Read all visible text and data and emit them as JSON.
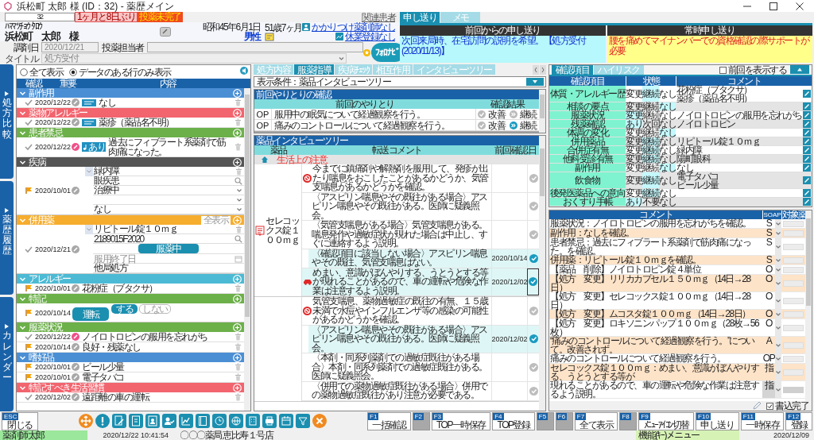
{
  "window": {
    "title": "浜松町 太郎 様 (ID：32) - 薬歴メイン"
  },
  "patient": {
    "id": "32",
    "interval": "1ヶ月と8日ぶり",
    "exam_status": "投薬未完了",
    "related_link": "関連患者",
    "kana": "ﾊﾏﾏﾂﾁｮｳ ﾀﾛｳ",
    "name": "浜松町　太郎　様",
    "birthdate": "昭和45年6月1日",
    "age": "51歳7ヶ月",
    "sex": "男性",
    "pharmacist_link": "かかりつけ薬剤師なし",
    "leave_link": "休業登録なし"
  },
  "dispense": {
    "date_label": "調剤日",
    "date": "2020/12/21",
    "staff_label": "投薬担当者",
    "title_label": "タイトル",
    "title": "処方受付"
  },
  "logo": {
    "label": "ﾌｫﾛﾅﾋﾞ"
  },
  "handover": {
    "tabs": [
      {
        "label": "申し送り",
        "selected": true
      },
      {
        "label": "メモ",
        "selected": false
      }
    ],
    "previous": {
      "heading": "前回からの申し送り",
      "text": "次回来局時、在宅訪問の説明を希望。【処方受付(2020/11/13)】"
    },
    "permanent": {
      "heading": "常時申し送り",
      "text": "腰を痛めてマイナンバーでの資格確認の際サポートが必要"
    }
  },
  "side_tabs": [
    {
      "label": "処方比較"
    },
    {
      "label": "薬歴履歴"
    },
    {
      "label": "カレンダー"
    }
  ],
  "left_panel": {
    "filters": [
      {
        "label": "全て表示",
        "selected": false
      },
      {
        "label": "データのある行のみ表示",
        "selected": true
      }
    ],
    "columns": [
      "確認",
      "重要",
      "内容"
    ],
    "sections": [
      {
        "title": "副作用",
        "color": "#4a8fd4",
        "kind": "entries",
        "rows": [
          {
            "kind": "check",
            "date": "2020/12/22",
            "important": false,
            "badge": {
              "kind": "info"
            },
            "text": "なし"
          }
        ]
      },
      {
        "title": "薬物アレルギー",
        "color": "#f2646e",
        "kind": "entries",
        "rows": [
          {
            "kind": "check",
            "date": "2020/12/22",
            "important": false,
            "badge": {
              "kind": "info"
            },
            "text": "薬疹（薬品名不明）"
          }
        ]
      },
      {
        "title": "患者禁忌",
        "color": "#6cb04a",
        "kind": "entries",
        "rows": [
          {
            "kind": "check",
            "date": "2020/12/22",
            "important": true,
            "badge": {
              "kind": "note",
              "label": "あり"
            },
            "text": "過去にフィブラート系薬剤で筋肉痛になった。"
          }
        ]
      },
      {
        "title": "疾病",
        "color": "#555555",
        "kind": "form",
        "entry": {
          "kind": "flag",
          "date": "2020/10/01",
          "important": false
        },
        "fields": [
          {
            "kind": "text",
            "value": "緑内障"
          },
          {
            "kind": "search",
            "value": "眼疾患"
          },
          {
            "kind": "select",
            "value": "治療中"
          },
          {
            "kind": "select"
          },
          {
            "kind": "select",
            "value": "なし"
          }
        ]
      },
      {
        "title": "併用薬",
        "color": "#f6ad2e",
        "kind": "form",
        "show_all": "全表示",
        "entry": {
          "kind": "check",
          "date": "2020/12/21",
          "important": false
        },
        "fields": [
          {
            "kind": "text",
            "value": "リピトール錠１０ｍｇ"
          },
          {
            "kind": "search",
            "value": "2189015F2020"
          },
          {
            "kind": "status",
            "value": "服薬中"
          },
          {
            "kind": "date",
            "placeholder": "服用終了日"
          },
          {
            "kind": "plain",
            "value": "他局処方"
          }
        ]
      },
      {
        "title": "アレルギー",
        "color": "#4cbad4",
        "kind": "entries",
        "rows": [
          {
            "kind": "flag",
            "date": "2020/10/01",
            "important": false,
            "text": "花粉症（ブタクサ）"
          }
        ]
      },
      {
        "title": "特記",
        "color": "#6cb04a",
        "kind": "note",
        "entry": {
          "kind": "flag",
          "date": "2020/10/14"
        },
        "label": "運転",
        "options": [
          {
            "label": "する",
            "selected": true
          },
          {
            "label": "しない",
            "selected": false
          }
        ]
      },
      {
        "title": "服薬状況",
        "color": "#6cb04a",
        "kind": "entries",
        "rows": [
          {
            "kind": "check",
            "date": "2020/12/22",
            "important": true,
            "text": "ノイロトロピンの服用を忘れがち"
          },
          {
            "kind": "flag",
            "date": "2020/10/14",
            "important": false,
            "text": "良好・残薬なし"
          }
        ]
      },
      {
        "title": "嗜好品",
        "color": "#4a8fd4",
        "kind": "entries",
        "rows": [
          {
            "kind": "flag",
            "date": "2020/10/01",
            "important": false,
            "text": "ビール少量"
          },
          {
            "kind": "flag",
            "date": "2020/10/01",
            "important": false,
            "text": "電子タバコ"
          }
        ]
      },
      {
        "title": "特記すべき生活習慣",
        "color": "#f2646e",
        "kind": "entries",
        "rows": [
          {
            "kind": "check",
            "date": "2020/12/02",
            "important": false,
            "text": "遠距離の車の運転"
          }
        ]
      }
    ]
  },
  "middle": {
    "tabs": [
      {
        "label": "処方内容",
        "selected": false
      },
      {
        "label": "服薬指導",
        "selected": true
      },
      {
        "label": "疾病ﾁｪｯｸ",
        "selected": false
      },
      {
        "label": "相互作用",
        "selected": false
      },
      {
        "label": "インタビューツリー",
        "selected": false
      }
    ],
    "condition": "表示条件：薬品インタビューツリー",
    "previous": {
      "title": "前回やりとりの確認",
      "columns": [
        "前回のやりとり",
        "確認結果"
      ],
      "rows": [
        {
          "soap": "OP",
          "text": "服用中の眠気について経過観察を行う。",
          "options": [
            {
              "label": "改善",
              "selected": false
            },
            {
              "label": "継続",
              "selected": false
            }
          ]
        },
        {
          "soap": "OP",
          "text": "痛みのコントロールについて経過観察を行う。",
          "options": [
            {
              "label": "改善",
              "selected": false
            },
            {
              "label": "継続",
              "selected": true
            }
          ]
        }
      ]
    },
    "interview": {
      "title": "薬品インタビューツリー",
      "columns": [
        "薬品",
        "転送コメント",
        "前回確認日"
      ],
      "category": "生活上の注意",
      "drugs": [
        {
          "name": "セレコックス錠１００ｍｇ",
          "items": [
            {
              "kind": "alert",
              "text": "今までに鎮痛剤や解熱剤を服用して、発疹が出たり喘息をおこしたことがあるかどうか、気管支喘息があるかどうかを確認。",
              "checked": false,
              "selected": false,
              "children": [
                {
                  "text": "〈アスピリン喘息やその既往がある場合〉アスピリン喘息やその既往がある。医師に疑義照会。",
                  "checked": false,
                  "selected": false
                },
                {
                  "text": "〈気管支喘息がある場合〉気管支喘息がある。喘息発作や過敏症状が現れた場合は中止し、すぐに連絡するよう説明。",
                  "checked": false,
                  "selected": false
                },
                {
                  "text": "〈確認項目に該当しない場合〉アスピリン喘息やその既往、気管支喘息はない。",
                  "date": "2020/10/14",
                  "checked": true,
                  "selected": false
                }
              ]
            },
            {
              "kind": "car",
              "text": "めまい、意識がぼんやりする、うとうとする等が現れることがあるので、車の運転や危険な作業は注意するよう説明。",
              "date": "2020/12/02",
              "checked": true,
              "selected": true
            }
          ]
        },
        {
          "items": [
            {
              "kind": "alert",
              "text": "気管支喘息、薬物過敏症の既往の有無、１５歳未満で水痘やインフルエンザ等の感染の可能性があるかどうかを確認。",
              "checked": false,
              "selected": false,
              "children": [
                {
                  "text": "〈アスピリン喘息やその既往がある場合〉アスピリン喘息やその既往がある。医師に疑義照会。",
                  "date": "2020/12/02",
                  "checked": true,
                  "selected": false
                },
                {
                  "text": "〈本剤・同系列薬剤での過敏症既往がある場合〉本剤・同系列薬剤での過敏症既往がある。医師に疑義照会。",
                  "checked": false,
                  "selected": false
                },
                {
                  "text": "〈併用での薬物過敏症既往がある場合〉併用での薬物過敏症既往があり注意が必要である。",
                  "checked": false,
                  "selected": false
                }
              ]
            }
          ]
        }
      ]
    }
  },
  "checks": {
    "tabs": [
      {
        "label": "確認項目",
        "selected": true
      },
      {
        "label": "ハイリスク",
        "selected": false
      }
    ],
    "show_previous": {
      "label": "前回を表示する",
      "checked": false
    },
    "columns": [
      "確認項目",
      "状態",
      "コメント"
    ],
    "rows": [
      {
        "item": "体質・アレルギー歴",
        "options": [
          {
            "label": "変更",
            "selected": false
          },
          {
            "label": "継続",
            "selected": true
          },
          {
            "label": "なし",
            "selected": false
          }
        ],
        "comment": [
          "花粉症（ブタクサ）",
          "薬疹（薬品名不明）"
        ]
      },
      {
        "item": "相談の要点",
        "options": [
          {
            "label": "変更",
            "selected": false
          },
          {
            "label": "継続",
            "selected": false
          },
          {
            "label": "なし",
            "selected": true
          }
        ]
      },
      {
        "item": "服薬状況",
        "options": [
          {
            "label": "変更",
            "selected": true
          },
          {
            "label": "継続",
            "selected": false
          },
          {
            "label": "なし",
            "selected": false
          }
        ],
        "comment": [
          "ノイロトロピンの服用を忘れがち"
        ]
      },
      {
        "item": "残薬確認",
        "options": [
          {
            "label": "あり",
            "selected": true
          },
          {
            "label": "次回",
            "selected": false
          },
          {
            "label": "なし",
            "selected": false
          }
        ],
        "comment": [
          "ノイロトロピン"
        ]
      },
      {
        "item": "体調の変化",
        "options": [
          {
            "label": "変更",
            "selected": false
          },
          {
            "label": "継続",
            "selected": false
          },
          {
            "label": "なし",
            "selected": true
          }
        ]
      },
      {
        "item": "併用薬品",
        "options": [
          {
            "label": "変更",
            "selected": false
          },
          {
            "label": "継続",
            "selected": true
          },
          {
            "label": "なし",
            "selected": false
          }
        ],
        "comment": [
          "リピトール錠１０ｍｇ"
        ]
      },
      {
        "item": "合併症有無",
        "options": [
          {
            "label": "変更",
            "selected": false
          },
          {
            "label": "継続",
            "selected": true
          },
          {
            "label": "なし",
            "selected": false
          }
        ],
        "comment": [
          "緑内障"
        ]
      },
      {
        "item": "他科受診有無",
        "options": [
          {
            "label": "変更",
            "selected": false
          },
          {
            "label": "継続",
            "selected": true
          },
          {
            "label": "なし",
            "selected": false
          }
        ],
        "comment": [
          "陽町眼科"
        ]
      },
      {
        "item": "副作用",
        "options": [
          {
            "label": "変更",
            "selected": false
          },
          {
            "label": "継続",
            "selected": false
          },
          {
            "label": "なし",
            "selected": true
          }
        ],
        "comment": [
          "なし"
        ]
      },
      {
        "item": "飲食物",
        "options": [
          {
            "label": "変更",
            "selected": false
          },
          {
            "label": "継続",
            "selected": true
          },
          {
            "label": "なし",
            "selected": false
          }
        ],
        "comment": [
          "電子タバコ",
          "ビール少量"
        ]
      },
      {
        "item": "後発医薬品への意向",
        "options": [
          {
            "label": "変更",
            "selected": false
          },
          {
            "label": "継続",
            "selected": true
          },
          {
            "label": "なし",
            "selected": false
          }
        ]
      },
      {
        "item": "おくすり手帳",
        "options": [
          {
            "label": "あり",
            "selected": true
          },
          {
            "label": "不要",
            "selected": false
          },
          {
            "label": "なし",
            "selected": false
          }
        ]
      }
    ]
  },
  "comments": {
    "columns": [
      "コメント",
      "SOAP",
      "対象薬"
    ],
    "rows": [
      {
        "text": "服薬状況：ノイロトロピンの服用を忘れがちを確認。",
        "soap": "S",
        "selected": false
      },
      {
        "text": "副作用：なしを確認。",
        "soap": "S",
        "selected": false
      },
      {
        "text": "患者禁忌：過去にフィブラート系薬剤で筋肉痛になった。を確認。",
        "soap": "S",
        "selected": false
      },
      {
        "text": "併用薬：リピトール錠１０ｍｇを確認。",
        "soap": "S",
        "selected": false
      },
      {
        "text": "【薬品　削除】ノイロトロピン錠４単位",
        "soap": "O",
        "selected": false
      },
      {
        "text": "【処方　変更】リリカカプセル１５０ｍｇ（14日→28日）",
        "soap": "O",
        "selected": false
      },
      {
        "text": "【処方　変更】セレコックス錠１００ｍｇ（14日→28日）",
        "soap": "O",
        "selected": false
      },
      {
        "text": "【処方　変更】ムコスタ錠１００ｍｇ（14日→28日）",
        "soap": "O",
        "selected": false
      },
      {
        "text": "【処方　変更】ロキソニンパップ１００ｍｇ（28枚→56枚）",
        "soap": "O",
        "selected": false
      },
      {
        "text": "“痛みのコントロールについて経過観察を行う。”について。改善されず。",
        "soap": "A",
        "selected": false
      },
      {
        "text": "痛みのコントロールについて経過観察を行う。",
        "soap": "OP",
        "selected": false
      },
      {
        "text": "セレコックス錠１００ｍｇ：めまい、意識がぼんやりする、うとうとする等が",
        "soap": "指",
        "selected": false
      },
      {
        "text": "現れることがあるので、車の運転や危険な作業は注意するよう説明。",
        "soap": "指",
        "selected": true
      }
    ],
    "done": {
      "label": "書込完了",
      "checked": true
    }
  },
  "toolbar": {
    "escape": {
      "key": "ESC",
      "label": "閉じる"
    },
    "function_keys": [
      {
        "key": "F1",
        "label": "一括確認",
        "disabled": false
      },
      {
        "key": "F2",
        "disabled": true
      },
      {
        "key": "F3",
        "label": "TOP一時保存",
        "disabled": false
      },
      {
        "key": "F4",
        "label": "TOP登録",
        "disabled": false
      },
      {
        "key": "F5",
        "disabled": true
      },
      {
        "key": "F6",
        "disabled": true
      },
      {
        "key": "F7",
        "label": "全て表示",
        "disabled": false
      },
      {
        "key": "F8",
        "disabled": true
      },
      {
        "key": "F9",
        "label": "ﾒﾆｭｰｱｲｺﾝ切替",
        "disabled": false
      },
      {
        "key": "F10",
        "label": "申し送り",
        "disabled": false
      },
      {
        "key": "F11",
        "label": "一時保存",
        "disabled": false
      },
      {
        "key": "F12",
        "label": "登録",
        "disabled": false
      }
    ]
  },
  "status_bar": {
    "user": "薬剤師太郎",
    "datetime": "2020/12/22 10:41:54",
    "store": "〇〇〇薬局 恵比寿１号店",
    "menu": "機能(ｷｰ)メニュー",
    "date": "2020/12/09"
  }
}
